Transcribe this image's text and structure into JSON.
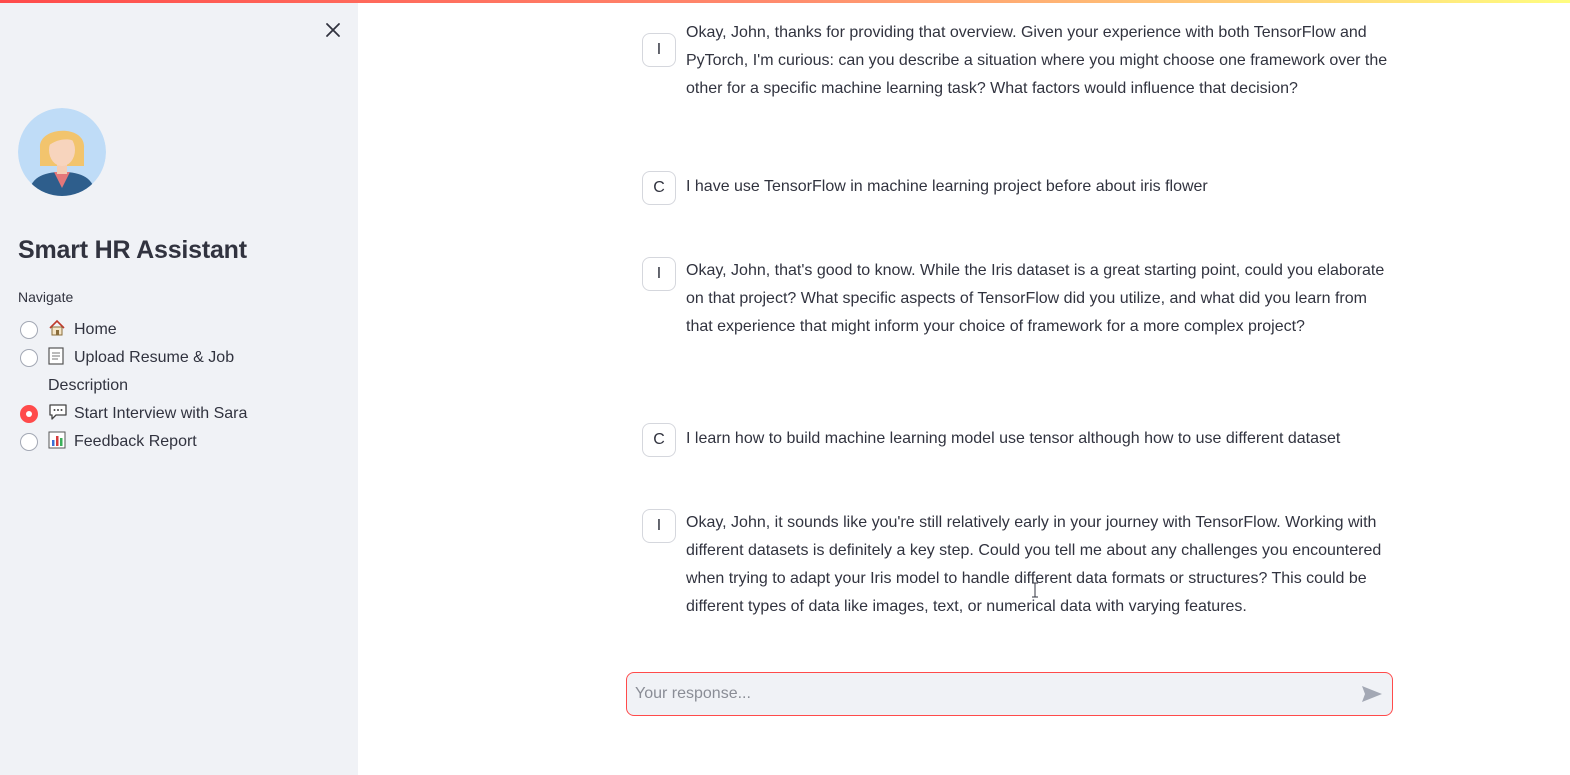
{
  "sidebar": {
    "title": "Smart HR Assistant",
    "nav_label": "Navigate",
    "nav_items": [
      {
        "icon": "house-icon",
        "label": "Home",
        "selected": false
      },
      {
        "icon": "page-icon",
        "label": "Upload Resume & Job Description",
        "selected": false
      },
      {
        "icon": "speech-bubble-icon",
        "label": "Start Interview with Sara",
        "selected": true
      },
      {
        "icon": "bar-chart-icon",
        "label": "Feedback Report",
        "selected": false
      }
    ],
    "close_icon": "close-icon",
    "avatar_icon": "avatar-woman-icon"
  },
  "chat": {
    "messages": [
      {
        "role": "I",
        "text": "Okay, John, thanks for providing that overview. Given your experience with both TensorFlow and PyTorch, I'm curious: can you describe a situation where you might choose one framework over the other for a specific machine learning task? What factors would influence that decision?"
      },
      {
        "role": "C",
        "text": "I have use TensorFlow in machine learning project before about iris flower"
      },
      {
        "role": "I",
        "text": "Okay, John, that's good to know. While the Iris dataset is a great starting point, could you elaborate on that project? What specific aspects of TensorFlow did you utilize, and what did you learn from that experience that might inform your choice of framework for a more complex project?"
      },
      {
        "role": "C",
        "text": "I learn how to build machine learning model use tensor although how to use different dataset"
      },
      {
        "role": "I",
        "text": "Okay, John, it sounds like you're still relatively early in your journey with TensorFlow. Working with different datasets is definitely a key step. Could you tell me about any challenges you encountered when trying to adapt your Iris model to handle different data formats or structures? This could be different types of data like images, text, or numerical data with varying features."
      }
    ]
  },
  "input": {
    "placeholder": "Your response...",
    "value": "",
    "send_icon": "send-icon"
  },
  "colors": {
    "accent": "#ff4b4b",
    "sidebar_bg": "#f0f2f6",
    "text": "#31333f"
  }
}
